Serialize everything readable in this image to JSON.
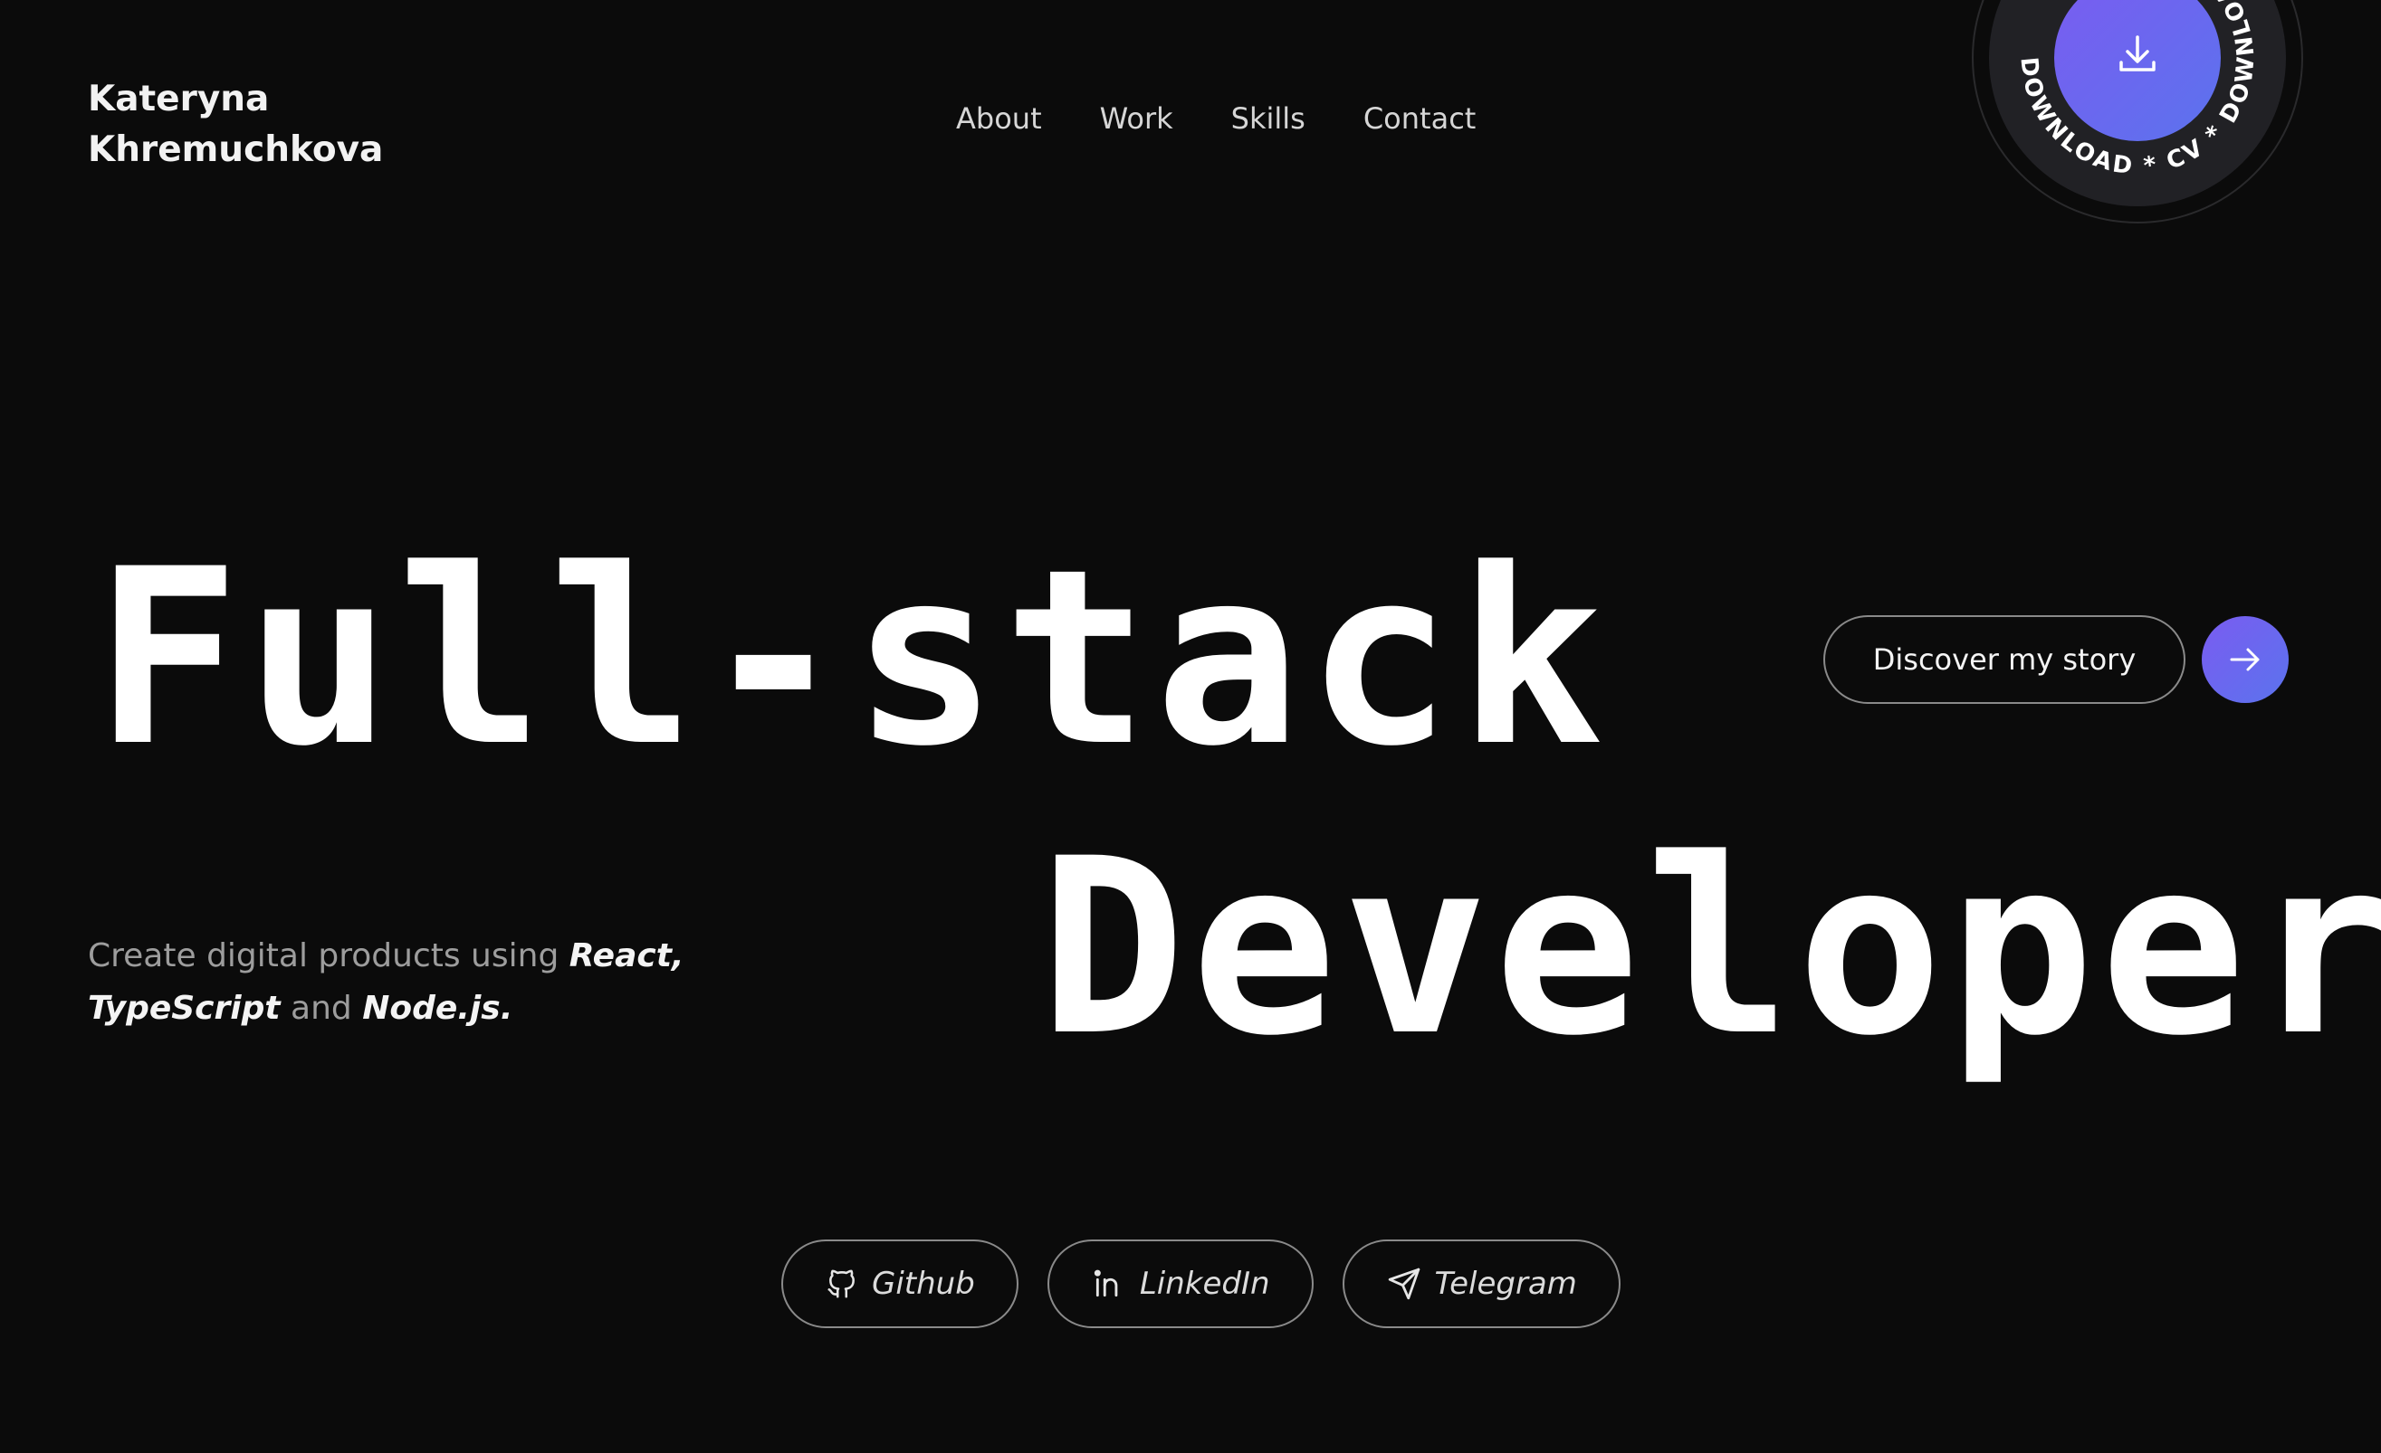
{
  "header": {
    "name_line1": "Kateryna",
    "name_line2": "Khremuchkova"
  },
  "nav": {
    "items": [
      "About",
      "Work",
      "Skills",
      "Contact"
    ]
  },
  "cv_badge": {
    "ring_text": "DOWNLOAD * CV * DOWNLOAD * CV * ",
    "icon": "download-icon",
    "gradient": [
      "#7a5cf0",
      "#5b73ee"
    ]
  },
  "hero": {
    "line1": "Full-stack",
    "line2": "Developer"
  },
  "cta": {
    "label": "Discover my story",
    "icon": "arrow-right-icon",
    "accent": "#6b67ef"
  },
  "tagline": {
    "prefix": "Create digital products using ",
    "tech1": "React,",
    "tech2": "TypeScript",
    "middle": " and ",
    "tech3": "Node.js."
  },
  "socials": [
    {
      "label": "Github",
      "icon": "github-icon"
    },
    {
      "label": "LinkedIn",
      "icon": "linkedin-icon"
    },
    {
      "label": "Telegram",
      "icon": "telegram-icon"
    }
  ],
  "colors": {
    "background": "#0b0b0b",
    "text": "#ffffff",
    "muted": "#9d9d9d"
  }
}
